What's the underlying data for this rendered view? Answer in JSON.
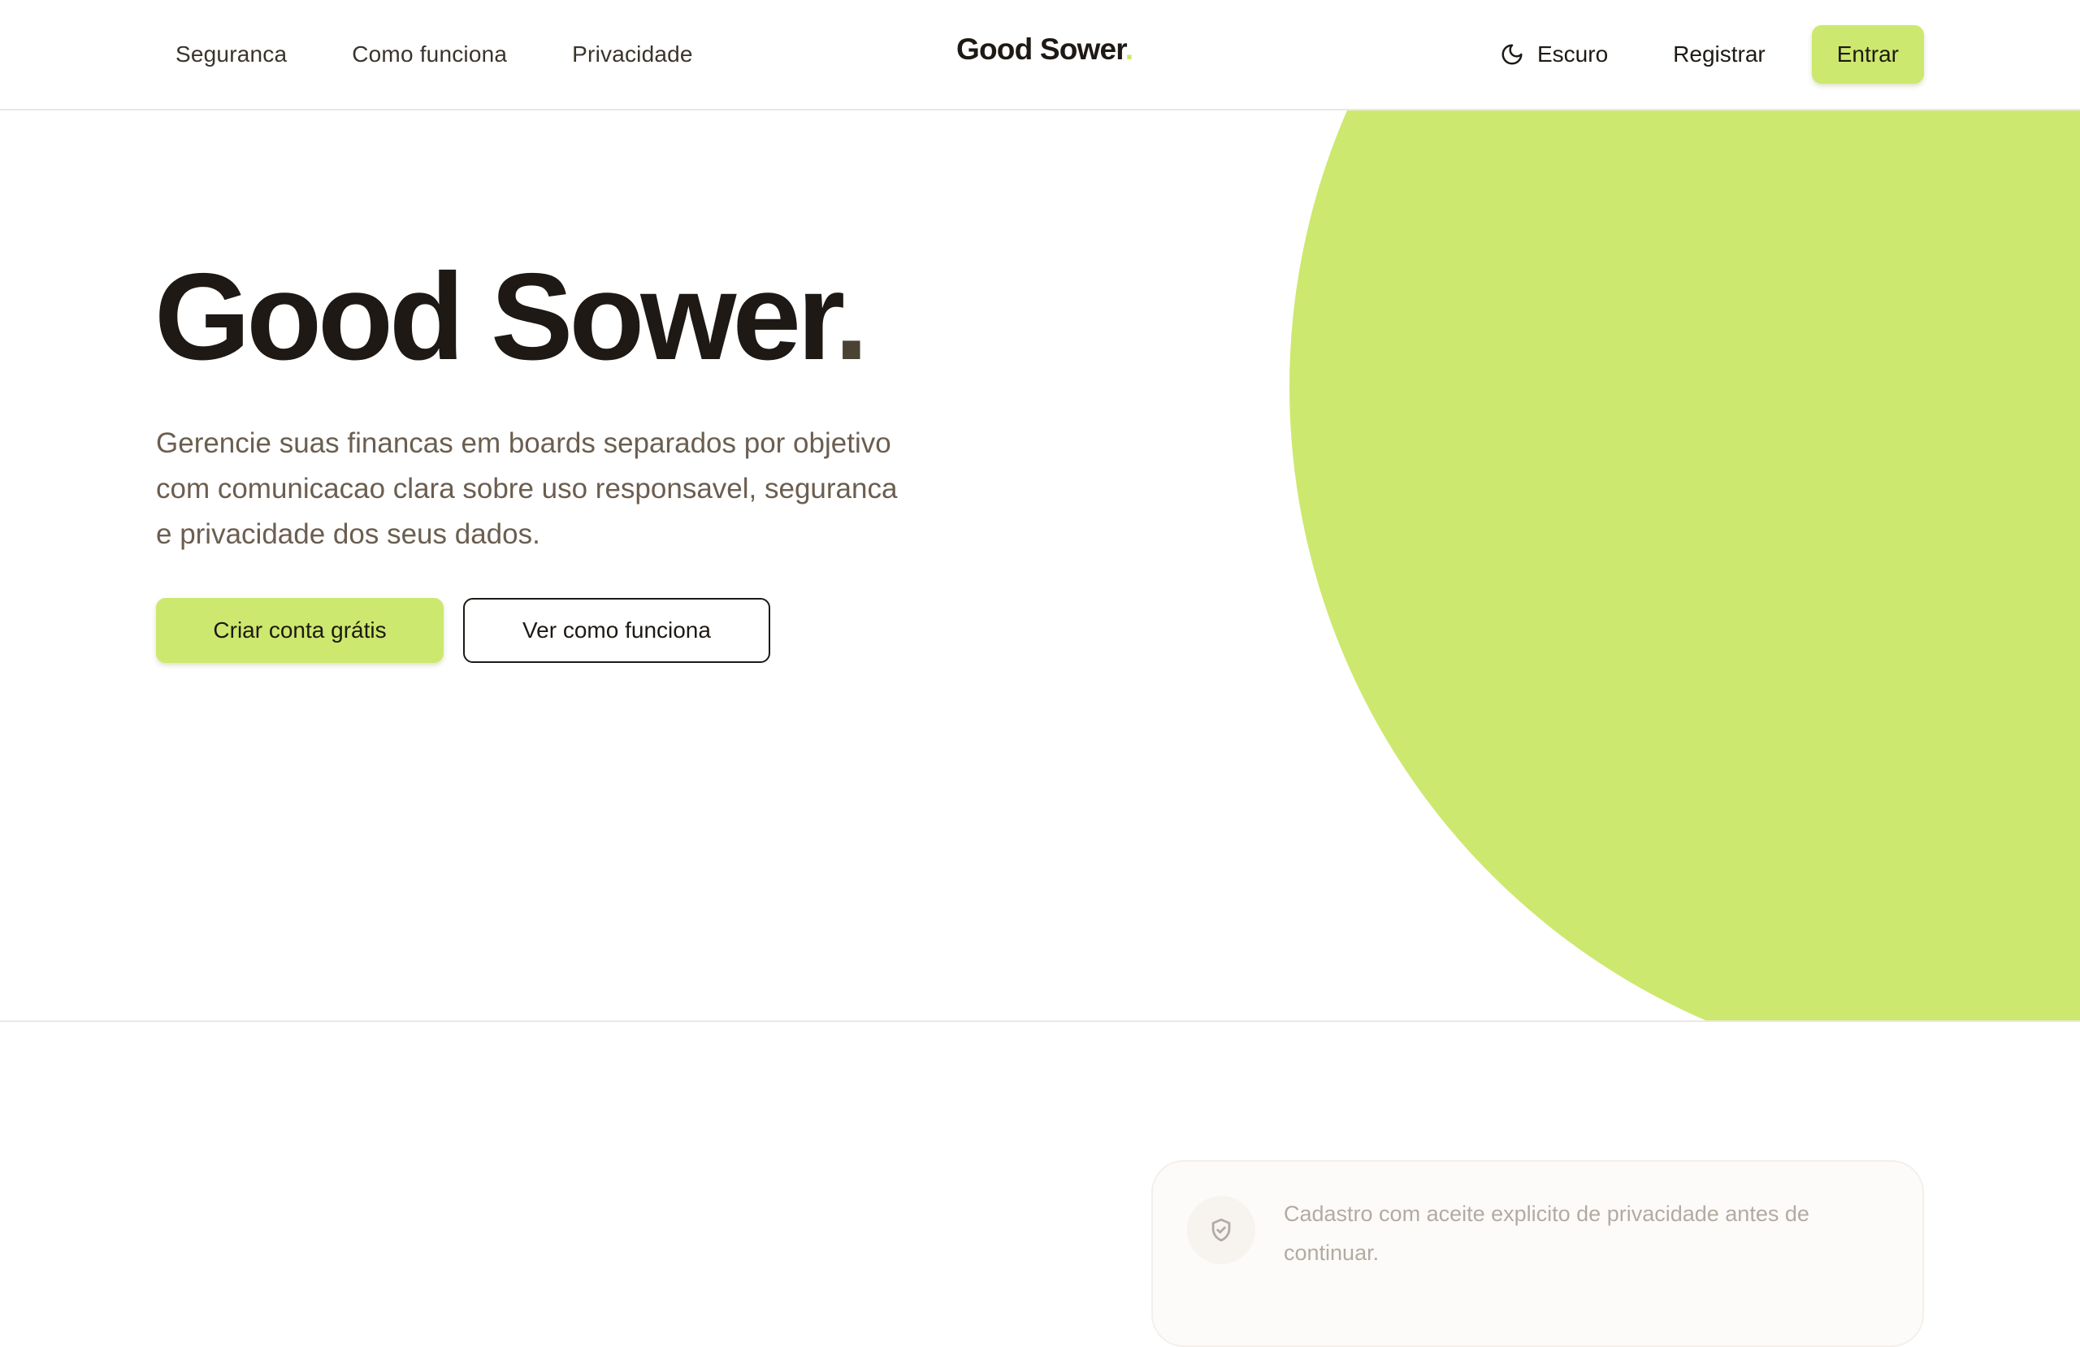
{
  "header": {
    "nav": [
      {
        "label": "Seguranca"
      },
      {
        "label": "Como funciona"
      },
      {
        "label": "Privacidade"
      }
    ],
    "brand": {
      "name": "Good Sower",
      "dot": "."
    },
    "theme_toggle": {
      "label": "Escuro",
      "icon": "moon-icon"
    },
    "register_label": "Registrar",
    "login_label": "Entrar"
  },
  "hero": {
    "title": "Good Sower",
    "title_dot": ".",
    "description": "Gerencie suas financas em boards separados por objetivo com comunicacao clara sobre uso responsavel, seguranca e privacidade dos seus dados.",
    "primary_cta": "Criar conta grátis",
    "secondary_cta": "Ver como funciona"
  },
  "info_card": {
    "icon": "shield-check-icon",
    "text": "Cadastro com aceite explicito de privacidade antes de continuar."
  },
  "colors": {
    "accent": "#cde86e",
    "text_dark": "#1e1914",
    "text_muted": "#6b5e50",
    "border": "#ebe8e4"
  }
}
